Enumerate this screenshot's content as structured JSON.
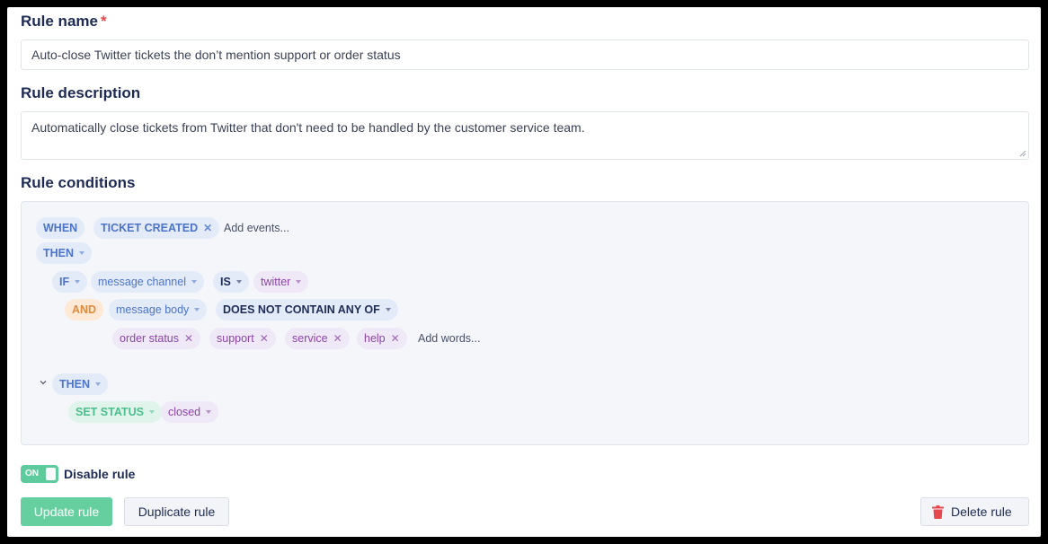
{
  "rule_name": {
    "label": "Rule name",
    "required_mark": "*",
    "value": "Auto-close Twitter tickets the don’t mention support or order status"
  },
  "rule_description": {
    "label": "Rule description",
    "value": "Automatically close tickets from Twitter that don't need to be handled by the customer service team."
  },
  "rule_conditions": {
    "label": "Rule conditions",
    "when": "WHEN",
    "event": "TICKET CREATED",
    "add_events": "Add events...",
    "then_1": "THEN",
    "if": "IF",
    "if_field": "message channel",
    "if_op": "IS",
    "if_value": "twitter",
    "and": "AND",
    "and_field": "message body",
    "and_op": "DOES NOT CONTAIN ANY OF",
    "words": [
      "order status",
      "support",
      "service",
      "help"
    ],
    "add_words": "Add words...",
    "then_2": "THEN",
    "action": "SET STATUS",
    "action_value": "closed"
  },
  "toggle": {
    "state": "ON",
    "label": "Disable rule"
  },
  "buttons": {
    "update": "Update rule",
    "duplicate": "Duplicate rule",
    "delete": "Delete rule"
  },
  "colors": {
    "accent_green": "#5ecb9c",
    "chip_blue": "#4c74c9",
    "chip_purple": "#8a46a8",
    "chip_orange": "#e08a3a",
    "danger_red": "#e5484d"
  },
  "icons": {
    "delete": "trash-icon",
    "collapse": "chevron-down-icon",
    "remove": "close-icon",
    "dropdown": "caret-down-icon"
  }
}
